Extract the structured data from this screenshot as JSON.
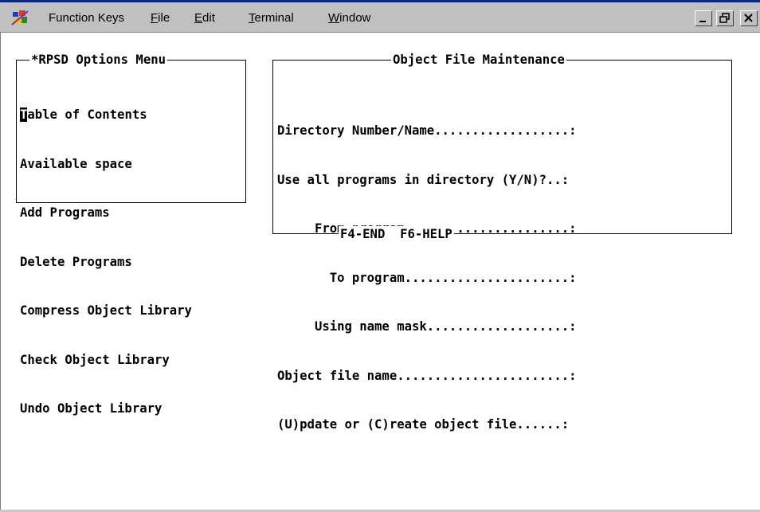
{
  "menubar": {
    "items": [
      {
        "label": "Function Keys",
        "accel": ""
      },
      {
        "label": "File",
        "accel": "F"
      },
      {
        "label": "Edit",
        "accel": "E"
      },
      {
        "label": "Terminal",
        "accel": "T"
      },
      {
        "label": "Window",
        "accel": "W"
      }
    ],
    "minimize_glyph": "_",
    "restore_glyph": "❐",
    "close_glyph": "✕"
  },
  "options_menu": {
    "title": "*RPSD Options Menu",
    "items": [
      "Table of Contents",
      "Available space",
      "Add Programs",
      "Delete Programs",
      "Compress Object Library",
      "Check Object Library",
      "Undo Object Library"
    ],
    "cursor_char": "T",
    "first_item_rest": "able of Contents"
  },
  "maintenance": {
    "title": "Object File Maintenance",
    "fields": [
      "Directory Number/Name..................:",
      "Use all programs in directory (Y/N)?..:",
      "     From program......................:",
      "       To program......................:",
      "     Using name mask...................:",
      "Object file name.......................:",
      "(U)pdate or (C)reate object file......:"
    ],
    "footer": "F4-END  F6-HELP"
  },
  "colors": {
    "menubar_bg": "#c0c0c0",
    "terminal_bg": "#ffffff",
    "text": "#000000",
    "top_accent": "#0b2a7a"
  },
  "icons": {
    "app_icon": "function-keys-app-icon",
    "minimize": "minimize-icon",
    "restore": "restore-icon",
    "close": "close-icon"
  }
}
